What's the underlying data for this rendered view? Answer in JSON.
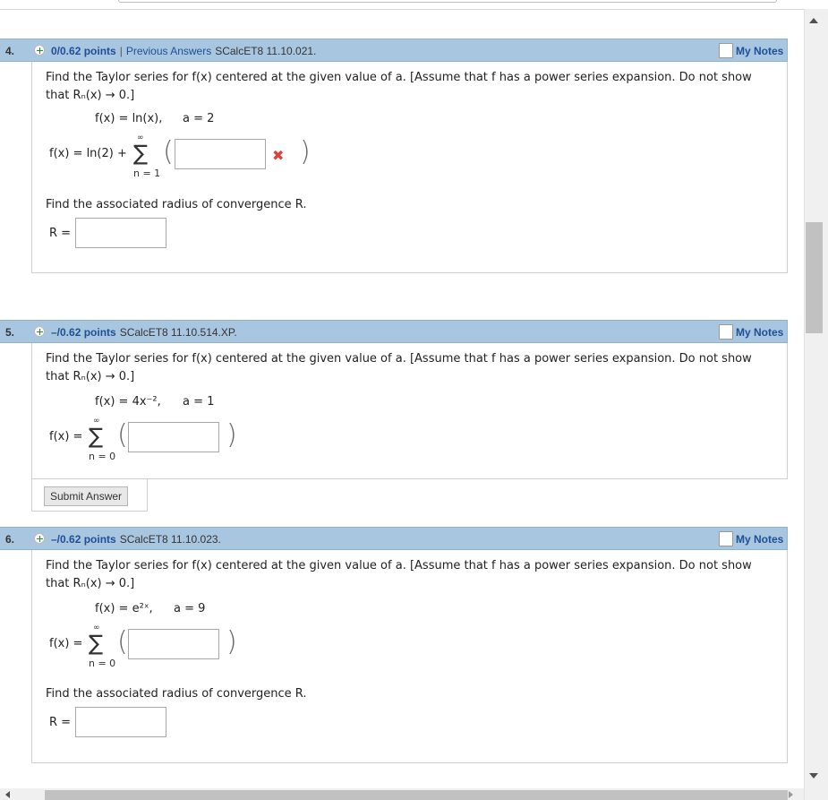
{
  "questions": [
    {
      "number": "4.",
      "points": "0/0.62 points",
      "separator": "|",
      "previous_answers": "Previous Answers",
      "reference": "SCalcET8 11.10.021.",
      "my_notes": "My Notes",
      "prompt_line1": "Find the Taylor series for f(x) centered at the given value of a. [Assume that f has a power series expansion. Do not show",
      "prompt_line2": "that Rₙ(x) → 0.]",
      "given_fx": "f(x) = ln(x),",
      "given_a": "a = 2",
      "series_lhs": "f(x) = ln(2) +",
      "sigma_top": "∞",
      "sigma_bottom": "n = 1",
      "answer_value": "",
      "answer_status": "incorrect",
      "radius_prompt": "Find the associated radius of convergence R.",
      "radius_label": "R =",
      "radius_value": ""
    },
    {
      "number": "5.",
      "points": "–/0.62 points",
      "reference": "SCalcET8 11.10.514.XP.",
      "my_notes": "My Notes",
      "prompt_line1": "Find the Taylor series for f(x) centered at the given value of a. [Assume that f has a power series expansion. Do not show",
      "prompt_line2": "that Rₙ(x) → 0.]",
      "given_fx": "f(x) = 4x⁻²,",
      "given_a": "a = 1",
      "series_lhs": "f(x) =",
      "sigma_top": "∞",
      "sigma_bottom": "n = 0",
      "answer_value": "",
      "submit_label": "Submit Answer"
    },
    {
      "number": "6.",
      "points": "–/0.62 points",
      "reference": "SCalcET8 11.10.023.",
      "my_notes": "My Notes",
      "prompt_line1": "Find the Taylor series for f(x) centered at the given value of a. [Assume that f has a power series expansion. Do not show",
      "prompt_line2": "that Rₙ(x) → 0.]",
      "given_fx": "f(x) = e²ˣ,",
      "given_a": "a = 9",
      "series_lhs": "f(x) =",
      "sigma_top": "∞",
      "sigma_bottom": "n = 0",
      "answer_value": "",
      "radius_prompt": "Find the associated radius of convergence R.",
      "radius_label": "R =",
      "radius_value": ""
    }
  ],
  "colors": {
    "header_bg": "#a9c6e1",
    "link": "#1e4f96",
    "incorrect": "#e0403b"
  },
  "icons": {
    "expand": "plus-circle-icon",
    "notes": "notes-checkbox-icon",
    "incorrect": "x-mark-icon"
  }
}
